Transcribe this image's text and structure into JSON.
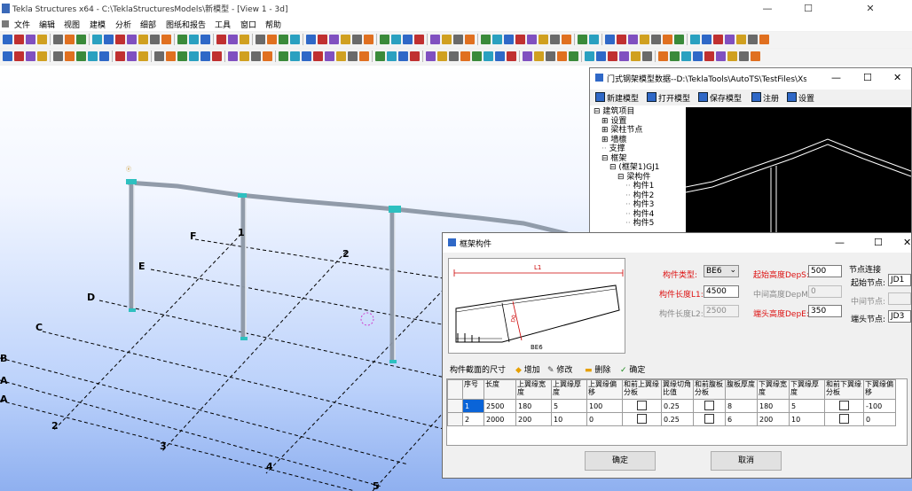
{
  "app": {
    "title": "Tekla Structures x64 - C:\\TeklaStructuresModels\\新模型 - [View 1 - 3d]",
    "minimize": "—",
    "maximize": "☐",
    "close": "✕"
  },
  "menu": [
    "文件",
    "编辑",
    "视图",
    "建模",
    "分析",
    "细部",
    "图纸和报告",
    "工具",
    "窗口",
    "帮助"
  ],
  "grid_labels": {
    "letters": [
      "F",
      "E",
      "D",
      "C",
      "B",
      "A",
      "A"
    ],
    "numbers": [
      "1",
      "2",
      "2",
      "3",
      "4",
      "5"
    ]
  },
  "param_window": {
    "title": "门式钢架模型数据--D:\\TeklaTools\\AutoTS\\TestFiles\\Xst...",
    "buttons": [
      "新建模型",
      "打开模型",
      "保存模型",
      "注册",
      "设置"
    ],
    "tree": [
      {
        "label": "建筑项目",
        "prefix": "⊟",
        "indent": 0
      },
      {
        "label": "设置",
        "prefix": "⊞",
        "indent": 1
      },
      {
        "label": "梁柱节点",
        "prefix": "⊞",
        "indent": 1
      },
      {
        "label": "墙檩",
        "prefix": "⊞",
        "indent": 1
      },
      {
        "label": "支撑",
        "prefix": "",
        "indent": 1
      },
      {
        "label": "框架",
        "prefix": "⊟",
        "indent": 1
      },
      {
        "label": "(框架1)GJ1",
        "prefix": "⊟",
        "indent": 2
      },
      {
        "label": "梁构件",
        "prefix": "⊟",
        "indent": 3
      },
      {
        "label": "构件1",
        "prefix": "",
        "indent": 4
      },
      {
        "label": "构件2",
        "prefix": "",
        "indent": 4
      },
      {
        "label": "构件3",
        "prefix": "",
        "indent": 4
      },
      {
        "label": "构件4",
        "prefix": "",
        "indent": 4
      },
      {
        "label": "构件5",
        "prefix": "",
        "indent": 4
      }
    ]
  },
  "frame_dialog": {
    "title": "框架构件",
    "sketch": {
      "dim_top": "L1",
      "dim_left": "D0",
      "dim_right": "D0",
      "name": "BE6"
    },
    "fields": {
      "type_label": "构件类型:",
      "type_value": "BE6",
      "len1_label": "构件长度L1:",
      "len1_value": "4500",
      "len2_label": "构件长度L2:",
      "len2_value": "2500",
      "start_h_label": "起始高度DepS:",
      "start_h_value": "500",
      "mid_h_label": "中间高度DepM:",
      "mid_h_value": "0",
      "end_h_label": "端头高度DepE:",
      "end_h_value": "350"
    },
    "nodes": {
      "title": "节点连接",
      "start_label": "起始节点:",
      "start_value": "JD1",
      "mid_label": "中间节点:",
      "mid_value": "",
      "end_label": "端头节点:",
      "end_value": "JD3"
    },
    "section_toolbar": {
      "title": "构件截面的尺寸",
      "add": "增加",
      "edit": "修改",
      "delete": "删除",
      "ok": "确定"
    },
    "table": {
      "headers": [
        "序号",
        "长度",
        "上翼缘宽度",
        "上翼缘厚度",
        "上翼缘偏移",
        "和前上翼缘分板",
        "翼缘切角比值",
        "和前腹板分板",
        "腹板厚度",
        "下翼缘宽度",
        "下翼缘厚度",
        "和前下翼缘分板",
        "下翼缘偏移"
      ],
      "rows": [
        [
          "1",
          "2500",
          "180",
          "5",
          "100",
          "",
          "0.25",
          "",
          "8",
          "180",
          "5",
          "",
          "-100"
        ],
        [
          "2",
          "2000",
          "200",
          "10",
          "0",
          "",
          "0.25",
          "",
          "6",
          "200",
          "10",
          "",
          "0"
        ]
      ]
    },
    "confirm": "确定",
    "cancel": "取消"
  }
}
